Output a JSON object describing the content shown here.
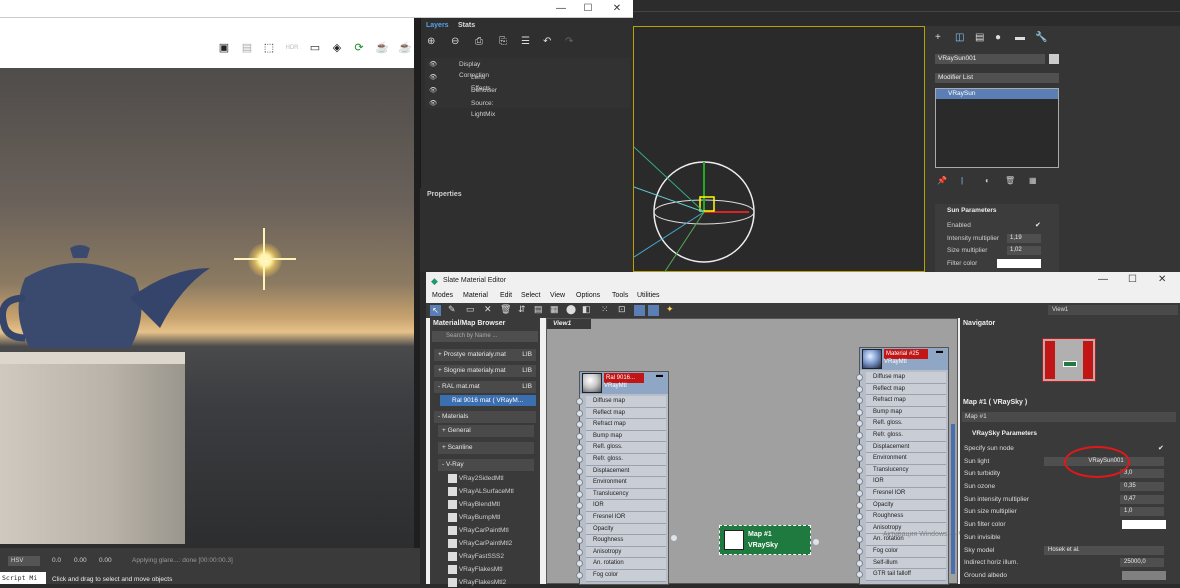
{
  "vfb": {
    "window_buttons": [
      "—",
      "☐",
      "✕"
    ],
    "status": {
      "color_mode": "HSV",
      "v1": "0.0",
      "v2": "0.00",
      "v3": "0.00",
      "message": "Applying glare...: done [00:00:00.3]"
    },
    "bottom": {
      "script": "Script Mi",
      "hint": "Click and drag to select and move objects"
    }
  },
  "layers": {
    "tabs": [
      "Layers",
      "Stats"
    ],
    "items": [
      "Display Correction",
      "Lens Effects",
      "Denoiser",
      "Source: LightMix"
    ],
    "properties_label": "Properties"
  },
  "command": {
    "object_name": "VRaySun001",
    "modifier_list": "Modifier List",
    "stack_item": "VRaySun",
    "rollout_title": "Sun Parameters",
    "enabled_label": "Enabled",
    "intensity_label": "Intensity multiplier",
    "intensity_value": "1,19",
    "size_label": "Size multiplier",
    "size_value": "1,02",
    "filter_label": "Filter color"
  },
  "sme": {
    "title": "Slate Material Editor",
    "window_buttons": [
      "—",
      "☐",
      "✕"
    ],
    "menu": [
      "Modes",
      "Material",
      "Edit",
      "Select",
      "View",
      "Options",
      "Tools",
      "Utilities"
    ],
    "view_dropdown": "View1",
    "browser": {
      "title": "Material/Map Browser",
      "search_placeholder": "Search by Name ...",
      "libs": [
        {
          "name": "+ Prostye materialy.mat",
          "tag": "LIB"
        },
        {
          "name": "+ Slognie materialy.mat",
          "tag": "LIB"
        },
        {
          "name": "- RAL mat.mat",
          "tag": "LIB"
        }
      ],
      "selected": "Ral 9016 mat  ( VRayM...",
      "materials_label": "- Materials",
      "cats": [
        "+ General",
        "+ Scanline",
        "- V-Ray"
      ],
      "vray": [
        "VRay2SidedMtl",
        "VRayALSurfaceMtl",
        "VRayBlendMtl",
        "VRayBumpMtl",
        "VRayCarPaintMtl",
        "VRayCarPaintMtl2",
        "VRayFastSSS2",
        "VRayFlakesMtl",
        "VRayFlakesMtl2"
      ]
    },
    "view_tab": "View1",
    "node1": {
      "name": "Ral 9016...",
      "type": "VRayMtl",
      "slots": [
        "Diffuse map",
        "Reflect map",
        "Refract map",
        "Bump map",
        "Refl. gloss.",
        "Refr. gloss.",
        "Displacement",
        "Environment",
        "Translucency",
        "IOR",
        "Fresnel IOR",
        "Opacity",
        "Roughness",
        "Anisotropy",
        "An. rotation",
        "Fog color"
      ]
    },
    "node2": {
      "name": "Material #25",
      "type": "VRayMtl",
      "slots": [
        "Diffuse map",
        "Reflect map",
        "Refract map",
        "Bump map",
        "Refl. gloss.",
        "Refr. gloss.",
        "Displacement",
        "Environment",
        "Translucency",
        "IOR",
        "Fresnel IOR",
        "Opacity",
        "Roughness",
        "Anisotropy",
        "An. rotation",
        "Fog color",
        "Self-illum",
        "GTR tail falloff"
      ]
    },
    "node3": {
      "name": "Map #1",
      "type": "VRaySky"
    },
    "navigator_title": "Navigator",
    "param_title": "Map #1  ( VRaySky )",
    "map_name": "Map #1",
    "rollout": "VRaySky Parameters",
    "params": [
      {
        "label": "Specify sun node",
        "value": "✔"
      },
      {
        "label": "Sun light",
        "value": "VRaySun001"
      },
      {
        "label": "Sun turbidity",
        "value": "3,0"
      },
      {
        "label": "Sun ozone",
        "value": "0,35"
      },
      {
        "label": "Sun intensity multiplier",
        "value": "0,47"
      },
      {
        "label": "Sun size multiplier",
        "value": "1,0"
      },
      {
        "label": "Sun filter color",
        "value": ""
      },
      {
        "label": "Sun invisible",
        "value": ""
      },
      {
        "label": "Sky model",
        "value": "Hosek et al."
      },
      {
        "label": "Indirect horiz illum.",
        "value": "25000,0"
      },
      {
        "label": "Ground albedo",
        "value": ""
      }
    ],
    "watermark": "Активация Windows — Чтобы активировать Windows, перейдите в раздел \"Параметры\"."
  }
}
